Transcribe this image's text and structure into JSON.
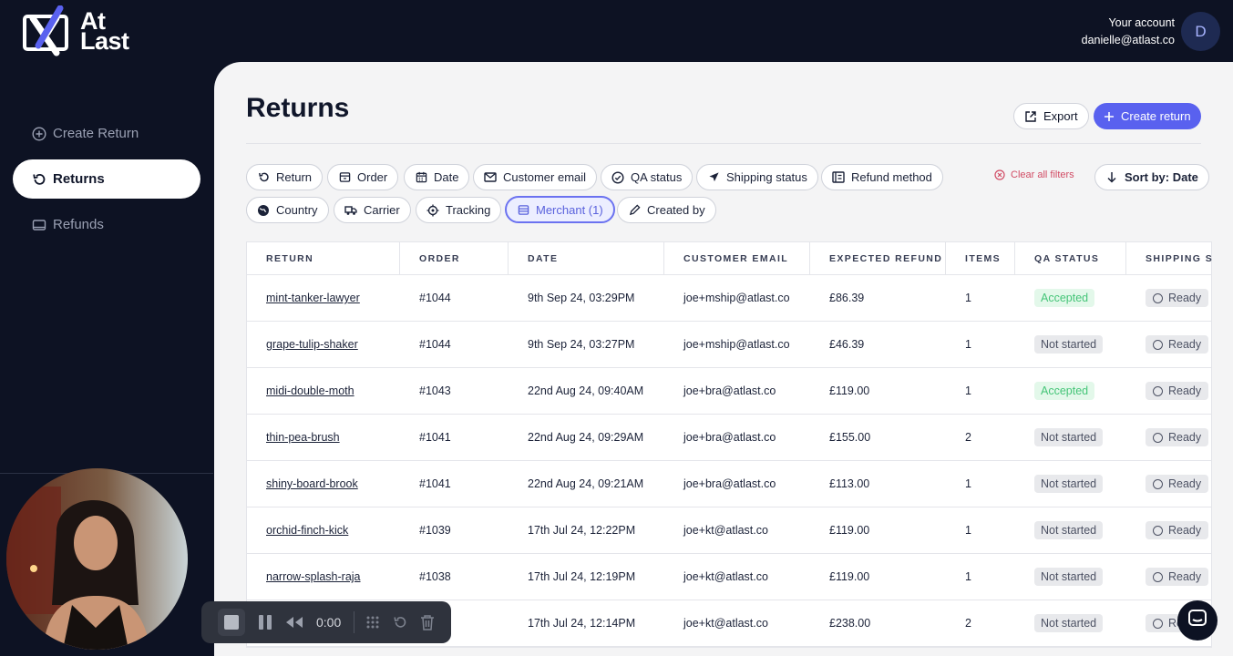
{
  "brand": {
    "logo_text_line1": "At",
    "logo_text_line2": "Last"
  },
  "account": {
    "label": "Your account",
    "email": "danielle@atlast.co",
    "avatar_initial": "D"
  },
  "sidebar": {
    "items": [
      {
        "label": "Create Return",
        "icon": "plus-circle-icon"
      },
      {
        "label": "Returns",
        "icon": "undo-icon",
        "active": true
      },
      {
        "label": "Refunds",
        "icon": "wallet-icon"
      }
    ]
  },
  "page": {
    "title": "Returns",
    "export_label": "Export",
    "create_label": "Create return"
  },
  "filters": {
    "row1": [
      "Return",
      "Order",
      "Date",
      "Customer email",
      "QA status",
      "Shipping status",
      "Refund method"
    ],
    "row2": [
      "Country",
      "Carrier",
      "Tracking",
      "Merchant (1)",
      "Created by"
    ],
    "clear_all": "Clear all filters",
    "sort": "Sort by: Date"
  },
  "table": {
    "columns": [
      "RETURN",
      "ORDER",
      "DATE",
      "CUSTOMER EMAIL",
      "EXPECTED REFUND",
      "ITEMS",
      "QA STATUS",
      "SHIPPING S"
    ],
    "rows": [
      {
        "return": "mint-tanker-lawyer",
        "order": "#1044",
        "date": "9th Sep 24, 03:29PM",
        "email": "joe+mship@atlast.co",
        "refund": "£86.39",
        "items": "1",
        "qa": "Accepted",
        "shipping": "Ready"
      },
      {
        "return": "grape-tulip-shaker",
        "order": "#1044",
        "date": "9th Sep 24, 03:27PM",
        "email": "joe+mship@atlast.co",
        "refund": "£46.39",
        "items": "1",
        "qa": "Not started",
        "shipping": "Ready"
      },
      {
        "return": "midi-double-moth",
        "order": "#1043",
        "date": "22nd Aug 24, 09:40AM",
        "email": "joe+bra@atlast.co",
        "refund": "£119.00",
        "items": "1",
        "qa": "Accepted",
        "shipping": "Ready"
      },
      {
        "return": "thin-pea-brush",
        "order": "#1041",
        "date": "22nd Aug 24, 09:29AM",
        "email": "joe+bra@atlast.co",
        "refund": "£155.00",
        "items": "2",
        "qa": "Not started",
        "shipping": "Ready"
      },
      {
        "return": "shiny-board-brook",
        "order": "#1041",
        "date": "22nd Aug 24, 09:21AM",
        "email": "joe+bra@atlast.co",
        "refund": "£113.00",
        "items": "1",
        "qa": "Not started",
        "shipping": "Ready"
      },
      {
        "return": "orchid-finch-kick",
        "order": "#1039",
        "date": "17th Jul 24, 12:22PM",
        "email": "joe+kt@atlast.co",
        "refund": "£119.00",
        "items": "1",
        "qa": "Not started",
        "shipping": "Ready"
      },
      {
        "return": "narrow-splash-raja",
        "order": "#1038",
        "date": "17th Jul 24, 12:19PM",
        "email": "joe+kt@atlast.co",
        "refund": "£119.00",
        "items": "1",
        "qa": "Not started",
        "shipping": "Ready"
      },
      {
        "return": "",
        "order": "",
        "date": "17th Jul 24, 12:14PM",
        "email": "joe+kt@atlast.co",
        "refund": "£238.00",
        "items": "2",
        "qa": "Not started",
        "shipping": "Ready"
      }
    ]
  },
  "recorder": {
    "time": "0:00"
  },
  "colors": {
    "accent": "#5961ef",
    "accepted_text": "#45c578",
    "danger": "#d14b64",
    "background": "#0d1223"
  }
}
